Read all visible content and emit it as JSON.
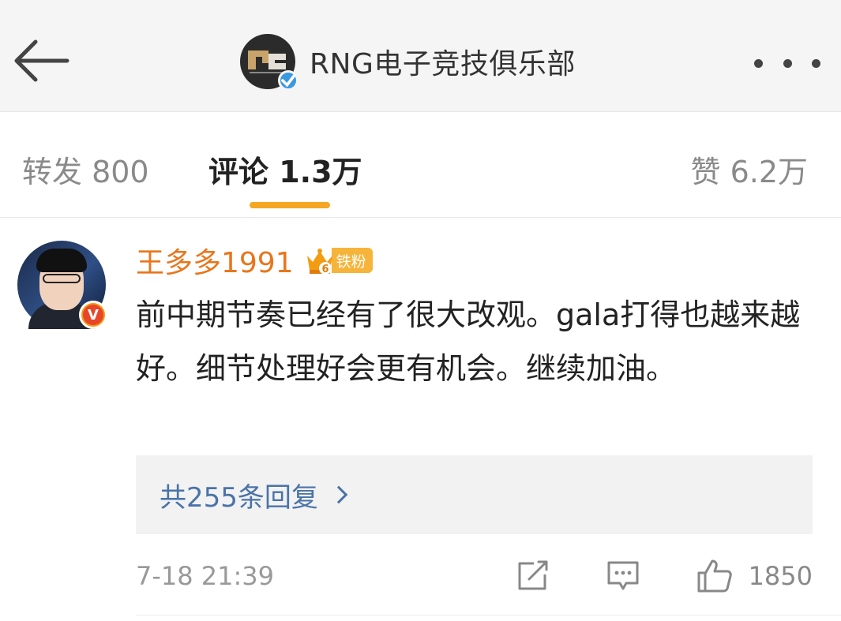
{
  "header": {
    "title": "RNG电子竞技俱乐部",
    "back_icon": "back-arrow-icon",
    "more_icon": "more-dots-icon",
    "avatar_icon": "rng-logo-icon",
    "verified_icon": "verified-badge-icon"
  },
  "tabs": [
    {
      "label": "转发 800"
    },
    {
      "label": "评论 1.3万"
    },
    {
      "label": "赞 6.2万"
    }
  ],
  "comment": {
    "username": "王多多1991",
    "fan_badge_label": "铁粉",
    "fan_badge_level": "6",
    "text": "前中期节奏已经有了很大改观。gala打得也越来越好。细节处理好会更有机会。继续加油。",
    "replies_label": "共255条回复",
    "timestamp": "7-18 21:39",
    "like_count": "1850"
  },
  "colors": {
    "accent_orange": "#f5a623",
    "username": "#e8761c",
    "link_blue": "#4a73a8",
    "verified_blue": "#3b98e0"
  }
}
